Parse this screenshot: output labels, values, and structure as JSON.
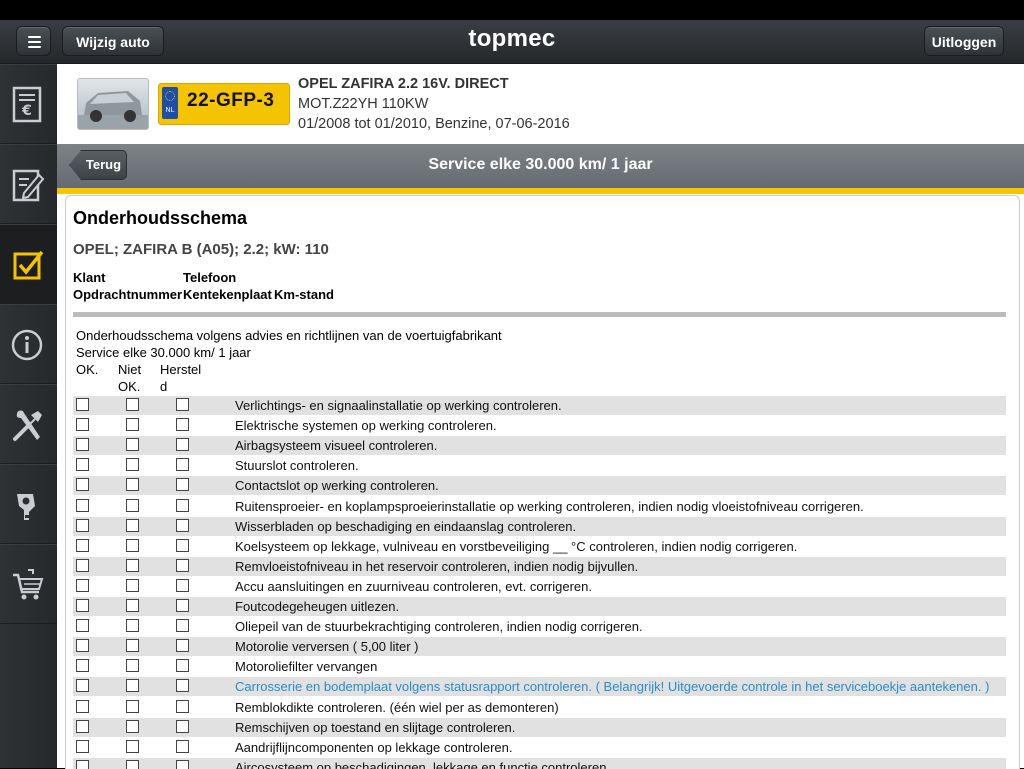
{
  "topbar": {
    "wijzig_label": "Wijzig auto",
    "logo": "topmec",
    "uitloggen_label": "Uitloggen"
  },
  "sidebar": {
    "items": [
      {
        "icon": "invoice-euro-icon"
      },
      {
        "icon": "edit-document-icon"
      },
      {
        "icon": "checklist-icon",
        "active": true
      },
      {
        "icon": "info-icon"
      },
      {
        "icon": "tools-icon"
      },
      {
        "icon": "tire-icon"
      },
      {
        "icon": "cart-icon"
      }
    ]
  },
  "car": {
    "plate_country": "NL",
    "plate": "22-GFP-3",
    "name": "OPEL ZAFIRA 2.2 16V. DIRECT",
    "engine": "MOT.Z22YH 110KW",
    "details": "01/2008 tot 01/2010, Benzine, 07-06-2016"
  },
  "subbar": {
    "back_label": "Terug",
    "title": "Service elke 30.000 km/ 1 jaar"
  },
  "schema": {
    "title": "Onderhoudsschema",
    "vehicle": "OPEL; ZAFIRA B (A05); 2.2; kW: 110",
    "fields": {
      "klant": "Klant",
      "telefoon": "Telefoon",
      "opdrachtnummer": "Opdrachtnummer",
      "kentekenplaat": "Kentekenplaat",
      "kmstand": "Km-stand"
    },
    "intro1": "Onderhoudsschema volgens advies en richtlijnen van de voertuigfabrikant",
    "intro2": "Service elke 30.000 km/ 1 jaar",
    "col_ok": "OK.",
    "col_niet_1": "Niet",
    "col_niet_2": "OK.",
    "col_herstel_1": "Herstel",
    "col_herstel_2": "d"
  },
  "checklist": [
    {
      "text": "Verlichtings- en signaalinstallatie op werking controleren."
    },
    {
      "text": "Elektrische systemen op werking controleren."
    },
    {
      "text": "Airbagsysteem visueel controleren."
    },
    {
      "text": "Stuurslot controleren."
    },
    {
      "text": "Contactslot op werking controleren."
    },
    {
      "text": "Ruitensproeier- en koplampsproeierinstallatie op werking controleren, indien nodig vloeistofniveau corrigeren."
    },
    {
      "text": "Wisserbladen op beschadiging en eindaanslag controleren."
    },
    {
      "text": "Koelsysteem op lekkage, vulniveau en vorstbeveiliging __ °C controleren, indien nodig corrigeren."
    },
    {
      "text": "Remvloeistofniveau in het reservoir controleren, indien nodig bijvullen."
    },
    {
      "text": "Accu aansluitingen en zuurniveau controleren, evt. corrigeren."
    },
    {
      "text": "Foutcodegeheugen uitlezen."
    },
    {
      "text": "Oliepeil van de stuurbekrachtiging controleren, indien nodig corrigeren."
    },
    {
      "text": "Motorolie verversen  ( 5,00 liter )"
    },
    {
      "text": "Motoroliefilter vervangen"
    },
    {
      "text": "Carrosserie en bodemplaat volgens statusrapport controleren. ( Belangrijk! Uitgevoerde controle in het serviceboekje aantekenen. )",
      "highlight": true
    },
    {
      "text": "Remblokdikte controleren. (één wiel per as demonteren)"
    },
    {
      "text": "Remschijven op toestand en slijtage controleren."
    },
    {
      "text": "Aandrijflijncomponenten op lekkage controleren."
    },
    {
      "text": "Aircosysteem op beschadigingen, lekkage en functie controleren."
    }
  ]
}
